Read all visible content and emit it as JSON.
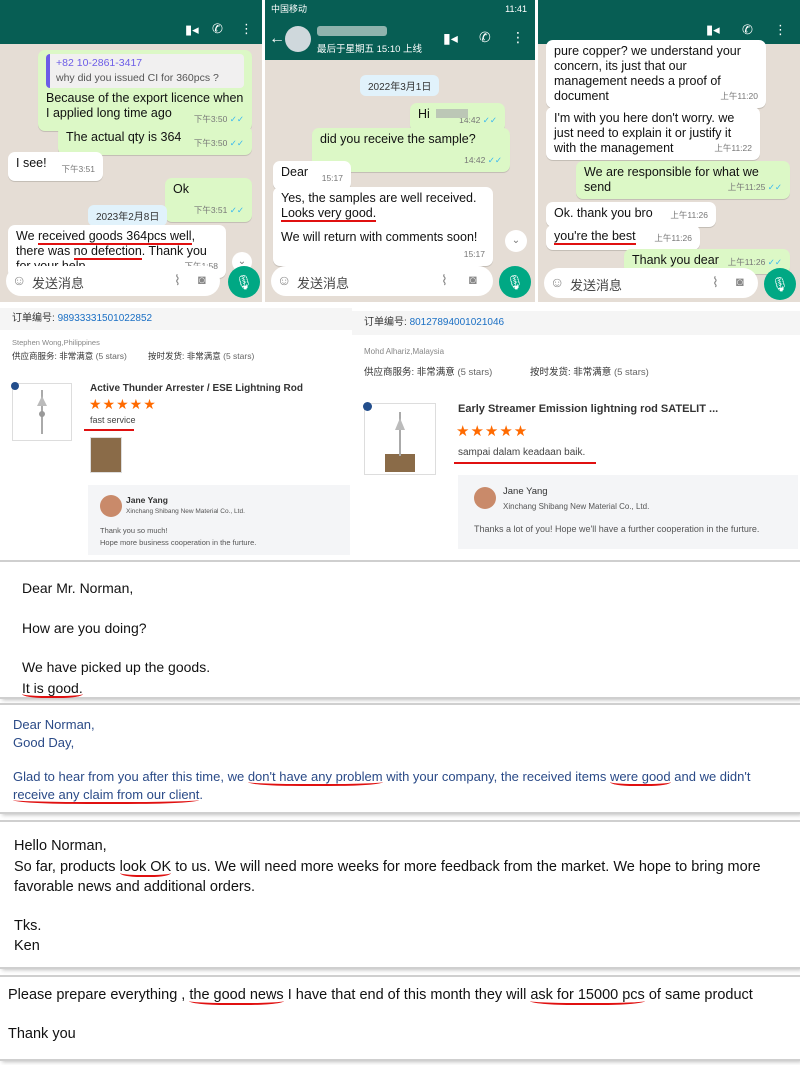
{
  "wa1": {
    "quote_number": "+82 10-2861-3417",
    "quote_text": "why did you issued CI for 360pcs ?",
    "messages": [
      {
        "text": "Because of the export licence when I applied long time ago",
        "time": "下午3:50"
      },
      {
        "text": "The actual qty is 364",
        "time": "下午3:50"
      },
      {
        "text": "I see!",
        "time": "下午3:51"
      },
      {
        "text": "Ok",
        "time": "下午3:51"
      }
    ],
    "date": "2023年2月8日",
    "last_msg": {
      "a": "We ",
      "b": "received goods 364pcs well",
      "c": ", there was ",
      "d": "no defection",
      "e": ". Thank you for your help.",
      "time": "下午1:58"
    },
    "input_placeholder": "发送消息"
  },
  "wa2": {
    "status_carrier": "中国移动",
    "status_time": "11:41",
    "last_seen": "最后于星期五 15:10 上线",
    "date": "2022年3月1日",
    "messages": [
      {
        "text": "Hi",
        "time": "14:42"
      },
      {
        "text": "did you receive the sample?",
        "time": "14:42"
      },
      {
        "text": "Dear",
        "time": "15:17"
      }
    ],
    "reply": {
      "line1": "Yes, the samples are well received.",
      "line2": "Looks very good.",
      "line3": "We will return with comments soon!",
      "time": "15:17"
    },
    "input_placeholder": "发送消息"
  },
  "wa3": {
    "messages": [
      {
        "text": "pure copper? we understand your concern, its just that our management  needs a proof of document",
        "time": "上午11:20"
      },
      {
        "text": "I'm with you here don't worry. we just need to explain it or justify it with the management",
        "time": "上午11:22"
      },
      {
        "text": "We are responsible for what we send",
        "time": "上午11:25"
      },
      {
        "text": "Ok. thank you bro",
        "time": "上午11:26"
      },
      {
        "text": "you're the best",
        "time": "上午11:26"
      },
      {
        "text": "Thank you dear",
        "time": "上午11:26"
      }
    ],
    "input_placeholder": "发送消息"
  },
  "review1": {
    "order_label": "订单编号:",
    "order_no": "98933331501022852",
    "buyer": "Stephen Wong,Philippines",
    "supplier_service_label": "供应商服务:",
    "supplier_service_value": "非常满意",
    "supplier_service_stars": "(5 stars)",
    "ontime_label": "按时发货:",
    "ontime_value": "非常满意",
    "ontime_stars": "(5 stars)",
    "product": "Active Thunder Arrester / ESE Lightning Rod",
    "rating": 5,
    "comment": "fast service",
    "reply_name": "Jane Yang",
    "reply_company": "Xinchang Shibang New Material Co., Ltd.",
    "reply_line1": "Thank you so much!",
    "reply_line2": "Hope more business cooperation in the furture."
  },
  "review2": {
    "order_label": "订单编号:",
    "order_no": "80127894001021046",
    "buyer": "Mohd Alhariz,Malaysia",
    "supplier_service_label": "供应商服务:",
    "supplier_service_value": "非常满意",
    "supplier_service_stars": "(5 stars)",
    "ontime_label": "按时发货:",
    "ontime_value": "非常满意",
    "ontime_stars": "(5 stars)",
    "product": "Early Streamer Emission lightning rod SATELIT ...",
    "rating": 5,
    "comment": "sampai dalam keadaan baik.",
    "reply_name": "Jane Yang",
    "reply_company": "Xinchang Shibang New Material Co., Ltd.",
    "reply_line": "Thanks a lot of you! Hope we'll have a further cooperation in the furture."
  },
  "email1": {
    "greeting": "Dear Mr. Norman,",
    "line1": "How are you doing?",
    "line2": "We have picked up the goods.",
    "line3": "It is good."
  },
  "email2": {
    "greeting": "Dear Norman,",
    "line1": "Good Day,",
    "p1": "Glad to hear from you after this time, we ",
    "p2": "don't have any problem",
    "p3": " with your company, the received items ",
    "p4": "were good",
    "p5": " and we didn't",
    "p6": "receive any claim from our client",
    "p7": "."
  },
  "email3": {
    "greeting": "Hello Norman,",
    "p1": "So far, products ",
    "p2": "look OK",
    "p3": " to us. We will need more weeks for more feedback from the market. We hope to bring more",
    "p4": "favorable news and additional orders.",
    "thanks": "Tks.",
    "name": "Ken"
  },
  "email4": {
    "p1": "Please prepare everything , ",
    "p2": "the good news",
    "p3": " I have that end of this month they will ",
    "p4": "ask for 15000 pcs",
    "p5": " of same product",
    "thanks": "Thank you"
  },
  "colors": {
    "wa_header": "#075e54",
    "wa_bg": "#e5ddd5",
    "wa_out": "#dcf8c6",
    "wa_mic": "#00a884",
    "underline": "#e01010",
    "star": "#ff6a00",
    "link": "#1a6fc4"
  }
}
